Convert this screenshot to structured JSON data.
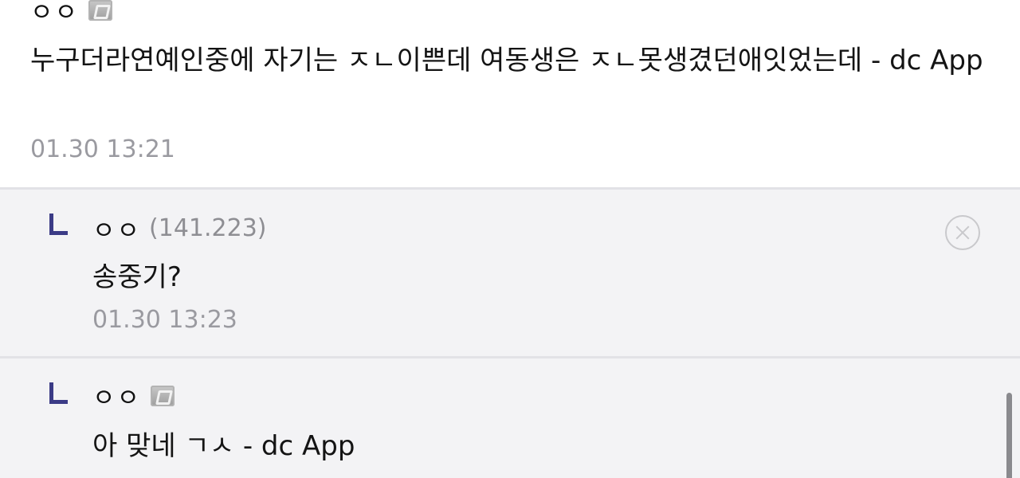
{
  "comments": [
    {
      "nickname": "ㅇㅇ",
      "text": "누구더라연예인중에 자기는 ㅈㄴ이쁜데 여동생은 ㅈㄴ못생겼던애잇었는데 - dc App",
      "time": "01.30 13:21",
      "app_icon": "dc-app-icon"
    },
    {
      "nickname": "ㅇㅇ",
      "ip": "(141.223)",
      "text": "송중기?",
      "time": "01.30 13:23",
      "delete_icon": "close-circle-icon"
    },
    {
      "nickname": "ㅇㅇ",
      "text": "아 맞네 ㄱㅅ - dc App",
      "app_icon": "dc-app-icon"
    }
  ],
  "colors": {
    "reply_mark": "#3b3b86",
    "reply_background": "#f3f3f5",
    "timestamp": "#9a9aa0"
  }
}
